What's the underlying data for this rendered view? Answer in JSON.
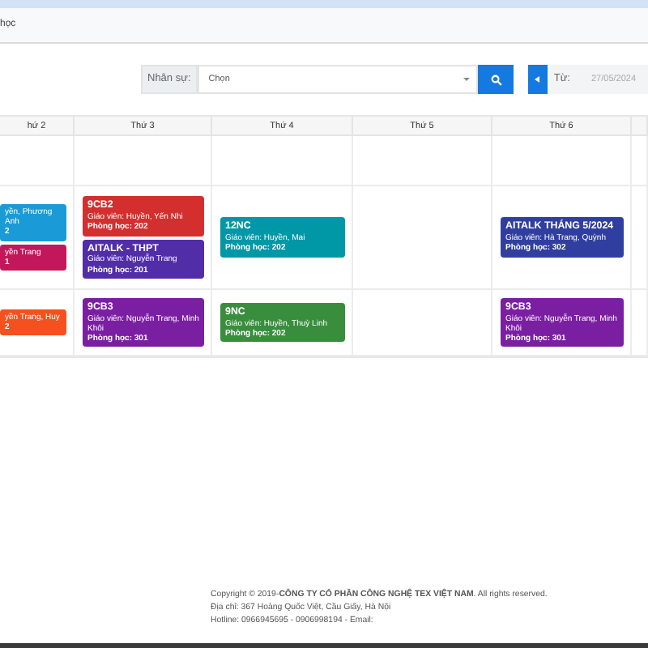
{
  "nav": {
    "item": "học"
  },
  "filter": {
    "staff_label": "Nhân sự:",
    "staff_value": "Chọn",
    "from_label": "Từ:",
    "from_placeholder": "27/05/2024"
  },
  "columns": [
    "hứ 2",
    "Thứ 3",
    "Thứ 4",
    "Thứ 5",
    "Thứ 6",
    ""
  ],
  "rows": [
    {
      "cells": [
        [],
        [],
        [],
        [],
        [],
        []
      ]
    },
    {
      "cells": [
        [
          {
            "teacher": "yền, Phương Anh",
            "room": "2",
            "color": "#1a9bd8"
          },
          {
            "teacher": "yền Trang",
            "room": "1",
            "color": "#c2185b"
          }
        ],
        [
          {
            "title": "9CB2",
            "teacher": "Giáo viên: Huyền, Yến Nhi",
            "room": "Phòng học: 202",
            "color": "#d32f2f"
          },
          {
            "title": "AITALK - THPT",
            "teacher": "Giáo viên: Nguyễn Trang",
            "room": "Phòng học: 201",
            "color": "#512da8"
          }
        ],
        [
          {
            "title": "12NC",
            "teacher": "Giáo viên: Huyền, Mai",
            "room": "Phòng học: 202",
            "color": "#0097a7"
          }
        ],
        [],
        [
          {
            "title": "AITALK THÁNG 5/2024",
            "teacher": "Giáo viên: Hà Trang, Quỳnh",
            "room": "Phòng học: 302",
            "color": "#303f9f"
          }
        ],
        []
      ]
    },
    {
      "cells": [
        [
          {
            "teacher": "yền Trang, Huy",
            "room": "2",
            "color": "#f4511e"
          }
        ],
        [
          {
            "title": "9CB3",
            "teacher": "Giáo viên: Nguyễn Trang, Minh Khôi",
            "room": "Phòng học: 301",
            "color": "#7b1fa2"
          }
        ],
        [
          {
            "title": "9NC",
            "teacher": "Giáo viên: Huyền, Thuỳ Linh",
            "room": "Phòng học: 202",
            "color": "#388e3c"
          }
        ],
        [],
        [
          {
            "title": "9CB3",
            "teacher": "Giáo viên: Nguyễn Trang, Minh Khôi",
            "room": "Phòng học: 301",
            "color": "#7b1fa2"
          }
        ],
        []
      ]
    }
  ],
  "footer": [
    "Copyright © 2019-**CÔNG TY CỔ PHẦN CÔNG NGHỆ TEX VIỆT NAM**. All rights reserved.",
    "Địa chỉ: 367 Hoàng Quốc Việt, Cầu Giấy, Hà Nội",
    "Hotline: 0966945695 - 0906998194 - Email:"
  ]
}
